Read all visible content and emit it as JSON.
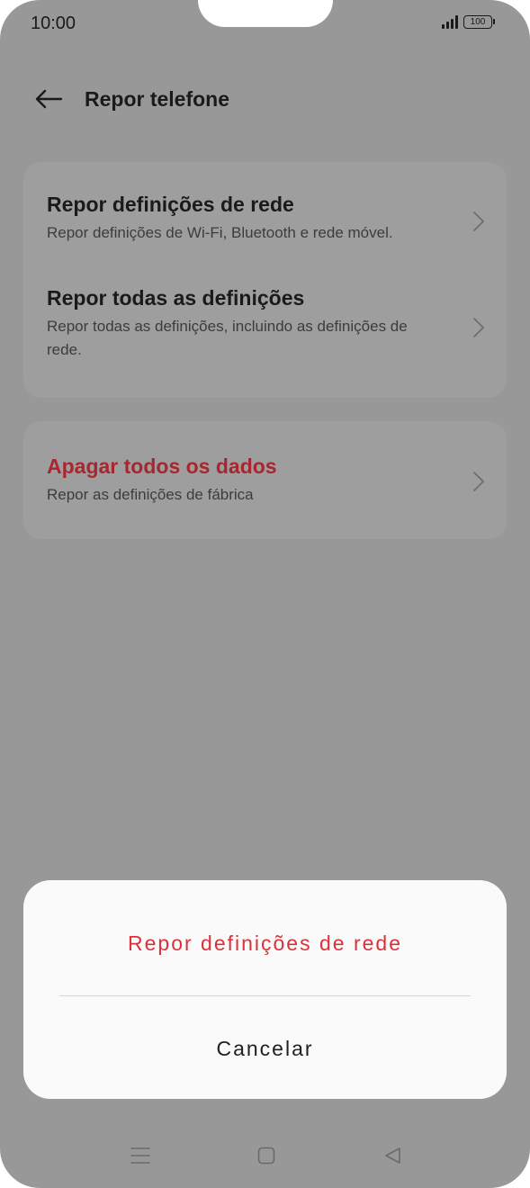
{
  "status_bar": {
    "time": "10:00",
    "battery": "100"
  },
  "header": {
    "title": "Repor telefone"
  },
  "card_reset": {
    "items": [
      {
        "title": "Repor definições de rede",
        "subtitle": "Repor definições de Wi-Fi, Bluetooth e rede móvel."
      },
      {
        "title": "Repor todas as definições",
        "subtitle": "Repor todas as definições, incluindo as definições de rede."
      }
    ]
  },
  "card_erase": {
    "title": "Apagar todos os dados",
    "subtitle": "Repor as definições de fábrica"
  },
  "sheet": {
    "confirm_label": "Repor definições de rede",
    "cancel_label": "Cancelar"
  },
  "colors": {
    "scrim": "#989898",
    "danger": "#a8272f",
    "confirm": "#d9333a",
    "sheet_bg": "#fafafa"
  },
  "icons": {
    "back": "arrow-left-icon",
    "chevron": "chevron-right-icon",
    "nav_menu": "menu-icon",
    "nav_home": "square-home-icon",
    "nav_back": "triangle-back-icon"
  }
}
